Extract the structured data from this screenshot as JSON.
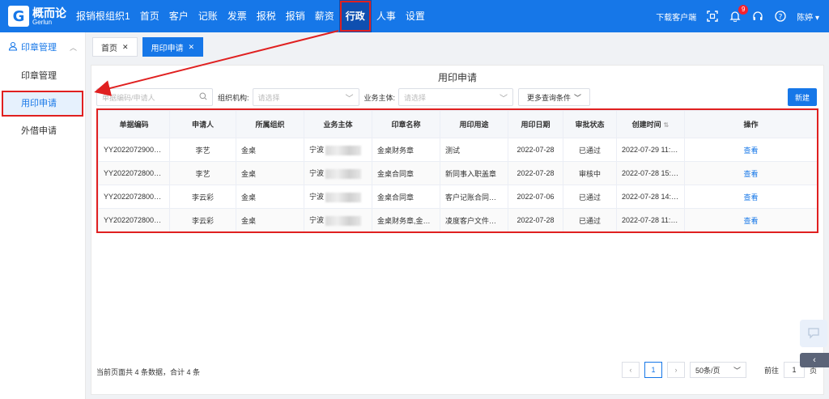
{
  "brand": {
    "name_cn": "概而论",
    "name_en": "Gerlun",
    "logo_glyph": "G"
  },
  "nav": {
    "items": [
      "报销根组织1",
      "首页",
      "客户",
      "记账",
      "发票",
      "报税",
      "报销",
      "薪资",
      "行政",
      "人事",
      "设置"
    ],
    "active": "行政"
  },
  "top_right": {
    "download": "下载客户端",
    "notification_count": "9",
    "user": "陈婷"
  },
  "sidebar": {
    "group": "印章管理",
    "items": [
      "印章管理",
      "用印申请",
      "外借申请"
    ],
    "active": "用印申请"
  },
  "tabs": [
    {
      "label": "首页"
    },
    {
      "label": "用印申请"
    }
  ],
  "page": {
    "title": "用印申请"
  },
  "filters": {
    "search_placeholder": "单据编码/申请人",
    "org_label": "组织机构:",
    "org_placeholder": "请选择",
    "entity_label": "业务主体:",
    "entity_placeholder": "请选择",
    "more_label": "更多查询条件",
    "new_label": "新建"
  },
  "table": {
    "columns": [
      "单据编码",
      "申请人",
      "所属组织",
      "业务主体",
      "印章名称",
      "用印用途",
      "用印日期",
      "审批状态",
      "创建时间",
      "操作"
    ],
    "rows": [
      {
        "code": "YY202207290000...",
        "applicant": "李艺",
        "org": "金桌",
        "entity": "宁波",
        "seal": "金桌财务章",
        "purpose": "测试",
        "date": "2022-07-28",
        "status": "已通过",
        "created": "2022-07-29 11:1...",
        "action": "查看"
      },
      {
        "code": "YY202207280000...",
        "applicant": "李艺",
        "org": "金桌",
        "entity": "宁波",
        "seal": "金桌合同章",
        "purpose": "新同事入职盖章",
        "date": "2022-07-28",
        "status": "审核中",
        "created": "2022-07-28 15:1...",
        "action": "查看"
      },
      {
        "code": "YY202207280000...",
        "applicant": "李云彩",
        "org": "金桌",
        "entity": "宁波",
        "seal": "金桌合同章",
        "purpose": "客户记账合同盖章",
        "date": "2022-07-06",
        "status": "已通过",
        "created": "2022-07-28 14:0...",
        "action": "查看"
      },
      {
        "code": "YY202207280000...",
        "applicant": "李云彩",
        "org": "金桌",
        "entity": "宁波",
        "seal": "金桌财务章,金桌...",
        "purpose": "凌度客户文件盖章",
        "date": "2022-07-28",
        "status": "已通过",
        "created": "2022-07-28 11:0...",
        "action": "查看"
      }
    ]
  },
  "footer": {
    "info": "当前页面共 4 条数据，合计 4 条",
    "current_page": "1",
    "page_size": "50条/页",
    "goto_label": "前往",
    "goto_value": "1",
    "goto_unit": "页"
  },
  "colors": {
    "primary": "#1677e8",
    "annotation": "#e02020"
  }
}
